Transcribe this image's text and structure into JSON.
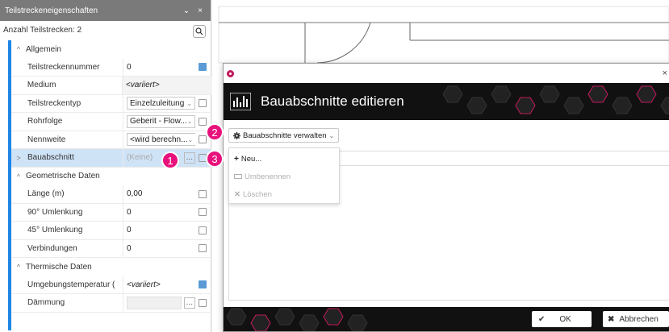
{
  "panel": {
    "title": "Teilstreckeneigenschaften",
    "collapse_glyph": "⌄",
    "close_glyph": "×",
    "count_label": "Anzahl Teilstrecken: 2",
    "search_icon": "search-icon",
    "categories": {
      "general": "Allgemein",
      "geometric": "Geometrische Daten",
      "thermal": "Thermische Daten"
    },
    "rows": {
      "teilstreckennummer": {
        "label": "Teilstreckennummer",
        "value": "0"
      },
      "medium": {
        "label": "Medium",
        "value": "<variiert>"
      },
      "teilstreckentyp": {
        "label": "Teilstreckentyp",
        "value": "Einzelzuleitung"
      },
      "rohrfolge": {
        "label": "Rohrfolge",
        "value": "Geberit - Flow..."
      },
      "nennweite": {
        "label": "Nennweite",
        "value": "<wird berechn..."
      },
      "bauabschnitt": {
        "label": "Bauabschnitt",
        "value": "(Keine)",
        "button": "..."
      },
      "laenge": {
        "label": "Länge (m)",
        "value": "0,00"
      },
      "umlenkung90": {
        "label": "90° Umlenkung",
        "value": "0"
      },
      "umlenkung45": {
        "label": "45° Umlenkung",
        "value": "0"
      },
      "verbindungen": {
        "label": "Verbindungen",
        "value": "0"
      },
      "umgebungstemperatur": {
        "label": "Umgebungstemperatur (",
        "value": "<variiert>"
      },
      "daemmung": {
        "label": "Dämmung",
        "value": "",
        "button": "..."
      }
    }
  },
  "dialog": {
    "close_glyph": "×",
    "title": "Bauabschnitte editieren",
    "manage_dropdown": "Bauabschnitte verwalten",
    "menu": {
      "new": "Neu...",
      "rename": "Umbenennen",
      "delete": "Löschen"
    },
    "ok_label": "OK",
    "cancel_label": "Abbrechen"
  },
  "callouts": {
    "one": "1",
    "two": "2",
    "three": "3"
  },
  "colors": {
    "accent": "#e8127c",
    "selection": "#cfe3f7",
    "category_bar": "#1f86e6",
    "banner": "#111111"
  }
}
